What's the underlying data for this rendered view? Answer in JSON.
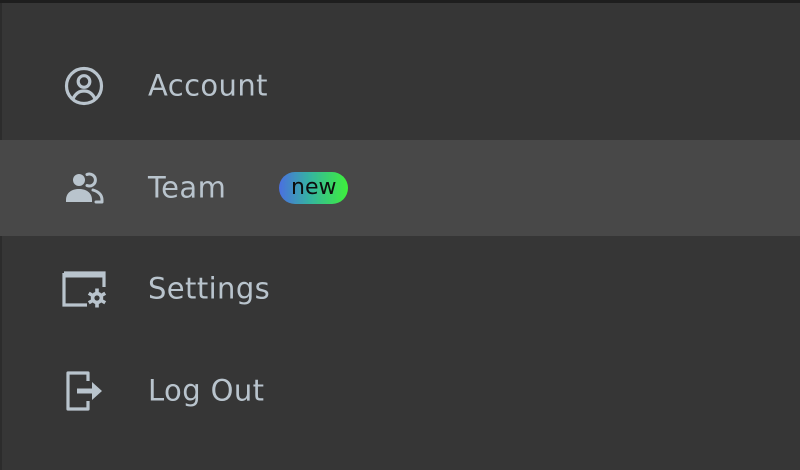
{
  "menu": {
    "items": [
      {
        "label": "Account",
        "icon": "user-circle-icon",
        "active": false
      },
      {
        "label": "Team",
        "icon": "users-icon",
        "active": true,
        "badge": "new"
      },
      {
        "label": "Settings",
        "icon": "window-gear-icon",
        "active": false
      },
      {
        "label": "Log Out",
        "icon": "logout-icon",
        "active": false
      }
    ]
  },
  "colors": {
    "background": "#363636",
    "active_background": "#484848",
    "text": "#b9c4cd",
    "badge_gradient_start": "#4a6fe0",
    "badge_gradient_end": "#3ef03a"
  }
}
